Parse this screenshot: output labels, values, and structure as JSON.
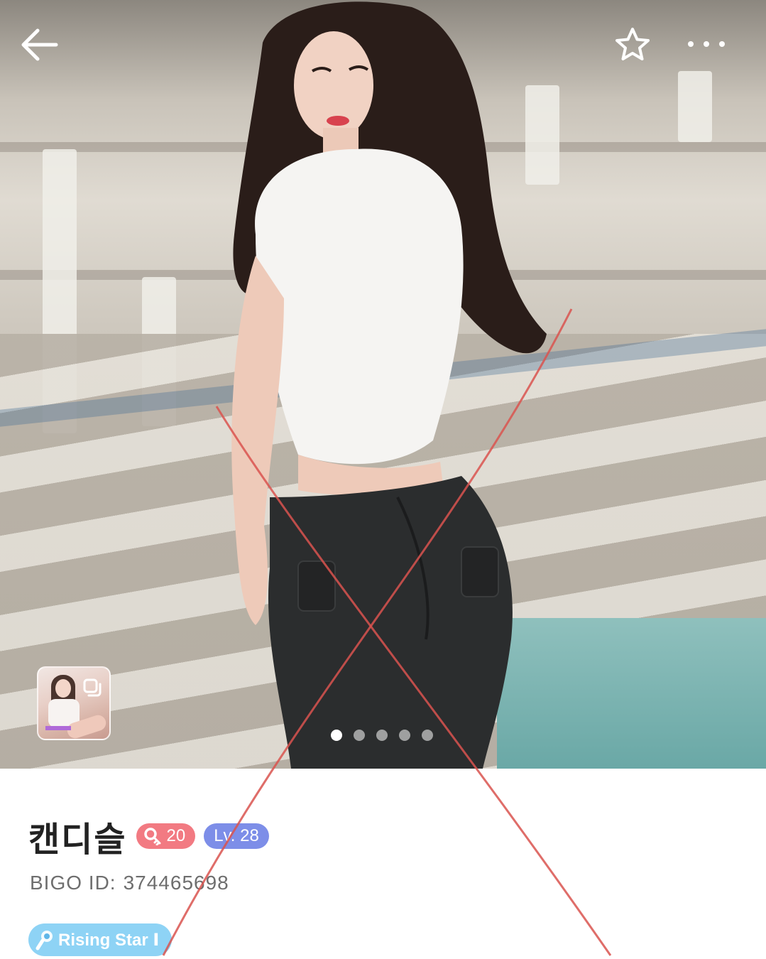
{
  "profile": {
    "name": "캔디슬",
    "fans_count": "20",
    "level": "Lv. 28",
    "id_label": "BIGO ID:",
    "id_value": "374465698",
    "rank_badge": "Rising Star Ⅰ"
  },
  "gallery": {
    "photo_count": 5,
    "active_index": 0
  },
  "icons": {
    "back": "back-arrow-icon",
    "favorite": "star-outline-icon",
    "more": "more-dots-icon",
    "multi_photo": "multi-photo-icon",
    "fans": "fans-key-icon",
    "rank": "microphone-icon"
  },
  "colors": {
    "fans_badge": "#f27a82",
    "level_badge": "#7d8ee8",
    "rank_badge": "#8ed3f5",
    "cross_mark": "#d9534f"
  }
}
